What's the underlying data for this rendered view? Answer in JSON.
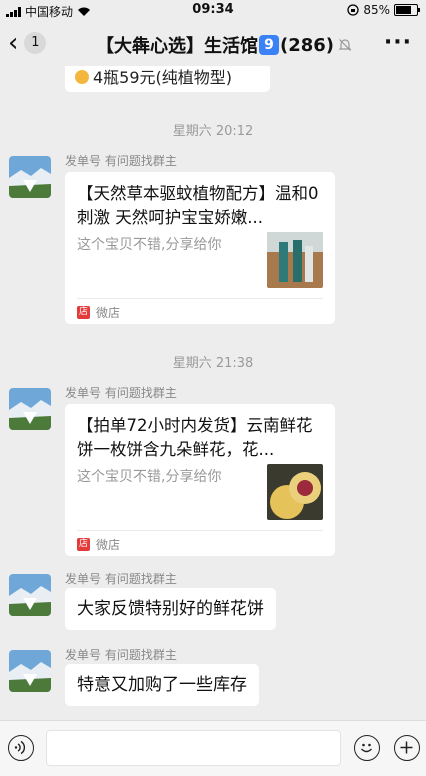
{
  "status_bar": {
    "carrier": "中国移动",
    "time": "09:34",
    "battery": "85%",
    "battery_level": 0.85
  },
  "nav": {
    "back_count": "1",
    "title_pre": "【大犇心选】生活馆",
    "title_num": "9",
    "title_post": "(286)"
  },
  "partial_message": {
    "text": "4瓶59元(纯植物型)"
  },
  "messages": [
    {
      "timestamp": "星期六 20:12",
      "sender": "发单号 有问题找群主",
      "card_title": "【天然草本驱蚊植物配方】温和0刺激 天然呵护宝宝娇嫩...",
      "card_desc": "这个宝贝不错,分享给你",
      "store_label": "微店",
      "store_icon_char": "店"
    },
    {
      "timestamp": "星期六 21:38",
      "sender": "发单号 有问题找群主",
      "card_title": "【拍单72小时内发货】云南鲜花饼一枚饼含九朵鲜花，花...",
      "card_desc": "这个宝贝不错,分享给你",
      "store_label": "微店",
      "store_icon_char": "店"
    },
    {
      "sender": "发单号 有问题找群主",
      "text": "大家反馈特别好的鲜花饼"
    },
    {
      "sender": "发单号 有问题找群主",
      "text": "特意又加购了一些库存"
    }
  ],
  "input": {
    "placeholder": ""
  },
  "icons": [
    "back-chevron-icon",
    "mute-bell-icon",
    "more-icon",
    "voice-icon",
    "emoji-icon",
    "plus-icon"
  ]
}
